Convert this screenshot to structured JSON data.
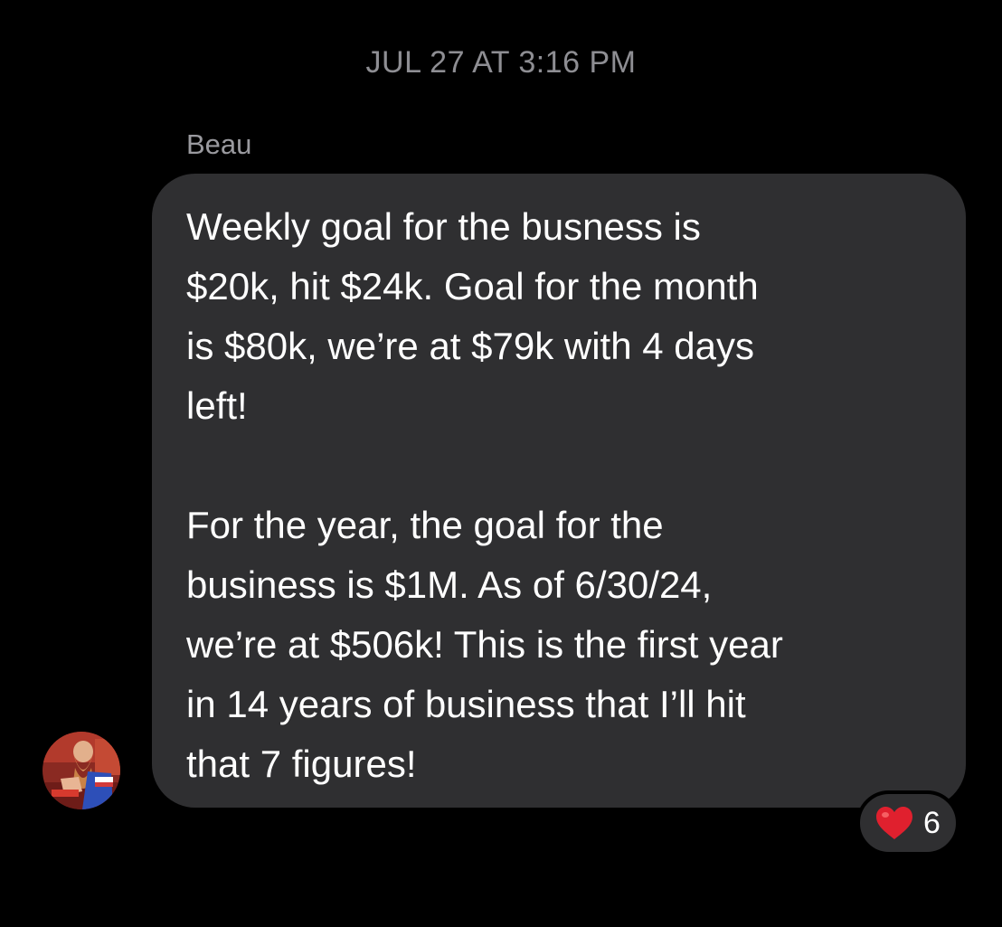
{
  "thread": {
    "timestamp": "JUL 27 AT 3:16 PM"
  },
  "message": {
    "sender": "Beau",
    "paragraphs": [
      "Weekly goal for the busness is\n$20k, hit $24k. Goal for the month\nis $80k, we’re at $79k with 4 days\nleft!",
      "For the year, the goal for the\nbusiness is $1M. As of 6/30/24,\nwe’re at $506k! This is the first year\nin 14 years of business that I’ll hit\nthat 7 figures!"
    ],
    "avatar_icon": "user-avatar-photo",
    "reaction": {
      "icon": "red-heart-icon",
      "color": "#e0202e",
      "count": "6"
    }
  },
  "colors": {
    "background": "#000000",
    "bubble": "#2f2f31",
    "timestamp": "#8e8e93",
    "sender": "#9a9a9f",
    "text": "#ffffff"
  }
}
